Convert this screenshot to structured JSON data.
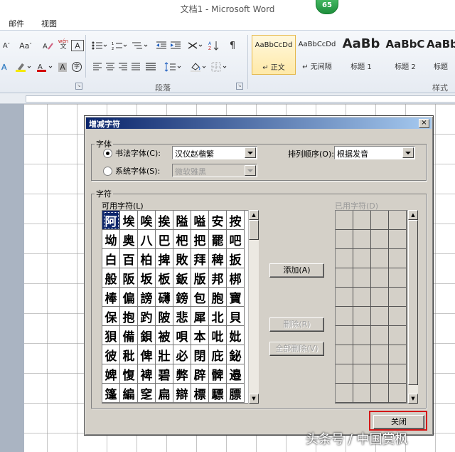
{
  "window": {
    "title": "文档1 - Microsoft Word",
    "badge": "65"
  },
  "menu": {
    "tabs": [
      "邮件",
      "视图"
    ]
  },
  "ribbon": {
    "font_size_label": "A",
    "aa_label": "Aa",
    "wen_label": "wén",
    "paragraph_group": "段落",
    "styles_group": "样式",
    "styles": [
      {
        "sample": "AaBbCcDd",
        "name": "↵ 正文"
      },
      {
        "sample": "AaBbCcDd",
        "name": "↵ 无间隔"
      },
      {
        "sample": "AaBb",
        "name": "标题 1"
      },
      {
        "sample": "AaBbC",
        "name": "标题 2"
      },
      {
        "sample": "AaBb",
        "name": "标题"
      }
    ],
    "colors": {
      "highlight": "#f5e800",
      "font_color": "#d40000"
    }
  },
  "dialog": {
    "title": "增减字符",
    "close_x": "×",
    "font_group": "字体",
    "calligraphy_font_label": "书法字体(C):",
    "calligraphy_font_value": "汉仪赵楷繁",
    "system_font_label": "系统字体(S):",
    "system_font_value": "微软雅黑",
    "sort_label": "排列顺序(O):",
    "sort_value": "根据发音",
    "chars_group": "字符",
    "available_label": "可用字符(L)",
    "used_label": "已用字符(D)",
    "available_chars": [
      "阿",
      "埃",
      "唉",
      "挨",
      "隘",
      "嗌",
      "安",
      "按",
      "坳",
      "奥",
      "八",
      "巴",
      "杷",
      "把",
      "罷",
      "吧",
      "白",
      "百",
      "柏",
      "捭",
      "敗",
      "拜",
      "稗",
      "扳",
      "般",
      "阪",
      "坂",
      "板",
      "鈑",
      "版",
      "邦",
      "梆",
      "棒",
      "偏",
      "謗",
      "礴",
      "鎊",
      "包",
      "胞",
      "寶",
      "保",
      "抱",
      "趵",
      "陂",
      "悲",
      "犀",
      "北",
      "貝",
      "狽",
      "備",
      "鋇",
      "被",
      "唄",
      "本",
      "吡",
      "妣",
      "彼",
      "秕",
      "俾",
      "壯",
      "必",
      "閉",
      "庇",
      "鉍",
      "婢",
      "愎",
      "裨",
      "碧",
      "弊",
      "辟",
      "髀",
      "邉",
      "篷",
      "編",
      "窆",
      "扁",
      "辯",
      "標",
      "驃",
      "膘"
    ],
    "add_button": "添加(A)",
    "remove_button": "删除(R)",
    "remove_all_button": "全部删除(V)",
    "close_button": "关闭"
  },
  "watermark": "头条号 / 中国赏枫"
}
